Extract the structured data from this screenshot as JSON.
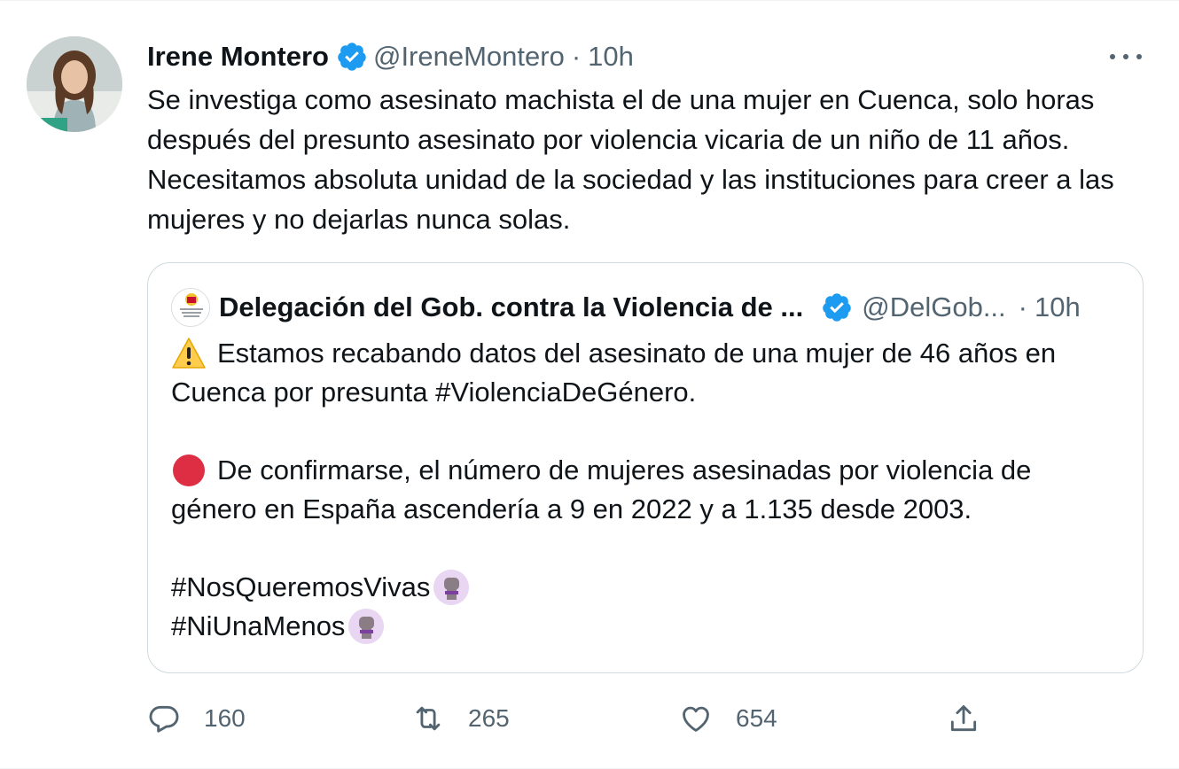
{
  "tweet": {
    "author_name": "Irene Montero",
    "handle": "@IreneMontero",
    "separator": "·",
    "time": "10h",
    "text": "Se investiga como asesinato machista el de una mujer en Cuenca, solo horas después del presunto asesinato por violencia vicaria de un niño de 11 años. Necesitamos absoluta unidad de la sociedad y las instituciones para creer a las mujeres y no dejarlas nunca solas."
  },
  "quoted": {
    "author_name": "Delegación del Gob. contra la Violencia de ...",
    "handle": "@DelGob...",
    "separator": "·",
    "time": "10h",
    "line1": "Estamos recabando datos del asesinato de una mujer de 46 años en",
    "line2": "Cuenca por presunta #ViolenciaDeGénero.",
    "line3": "De confirmarse, el número de mujeres asesinadas por violencia de",
    "line4": "género en España ascendería a 9 en 2022 y a 1.135 desde 2003.",
    "hashtag1": "#NosQueremosVivas",
    "hashtag2": "#NiUnaMenos"
  },
  "actions": {
    "replies": "160",
    "retweets": "265",
    "likes": "654"
  },
  "colors": {
    "text": "#0f1419",
    "secondary": "#536471",
    "verified": "#1d9bf0",
    "border": "#cfd9de",
    "red_circle": "#dd2e44",
    "warning": "#ffcc4d"
  },
  "icons": [
    "verified-badge-icon",
    "more-icon",
    "warning-icon",
    "red-circle-icon",
    "raised-fist-icon",
    "reply-icon",
    "retweet-icon",
    "like-icon",
    "share-icon"
  ]
}
